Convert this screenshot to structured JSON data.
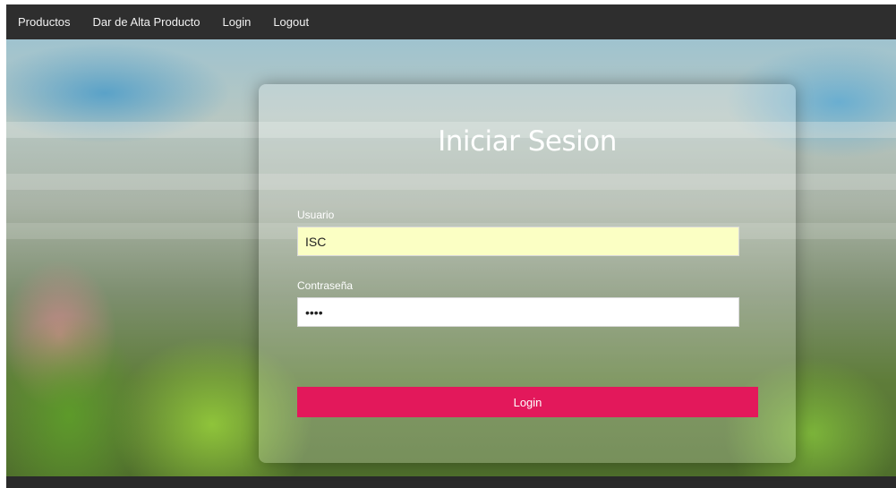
{
  "navbar": {
    "items": [
      {
        "label": "Productos"
      },
      {
        "label": "Dar de Alta Producto"
      },
      {
        "label": "Login"
      },
      {
        "label": "Logout"
      }
    ]
  },
  "login_form": {
    "title": "Iniciar Sesion",
    "username_label": "Usuario",
    "username_value": "ISC",
    "password_label": "Contraseña",
    "password_value": "••••",
    "submit_label": "Login"
  },
  "colors": {
    "navbar_bg": "#2e2e2e",
    "button_bg": "#e3185b",
    "username_field_bg": "#fbffc4"
  }
}
